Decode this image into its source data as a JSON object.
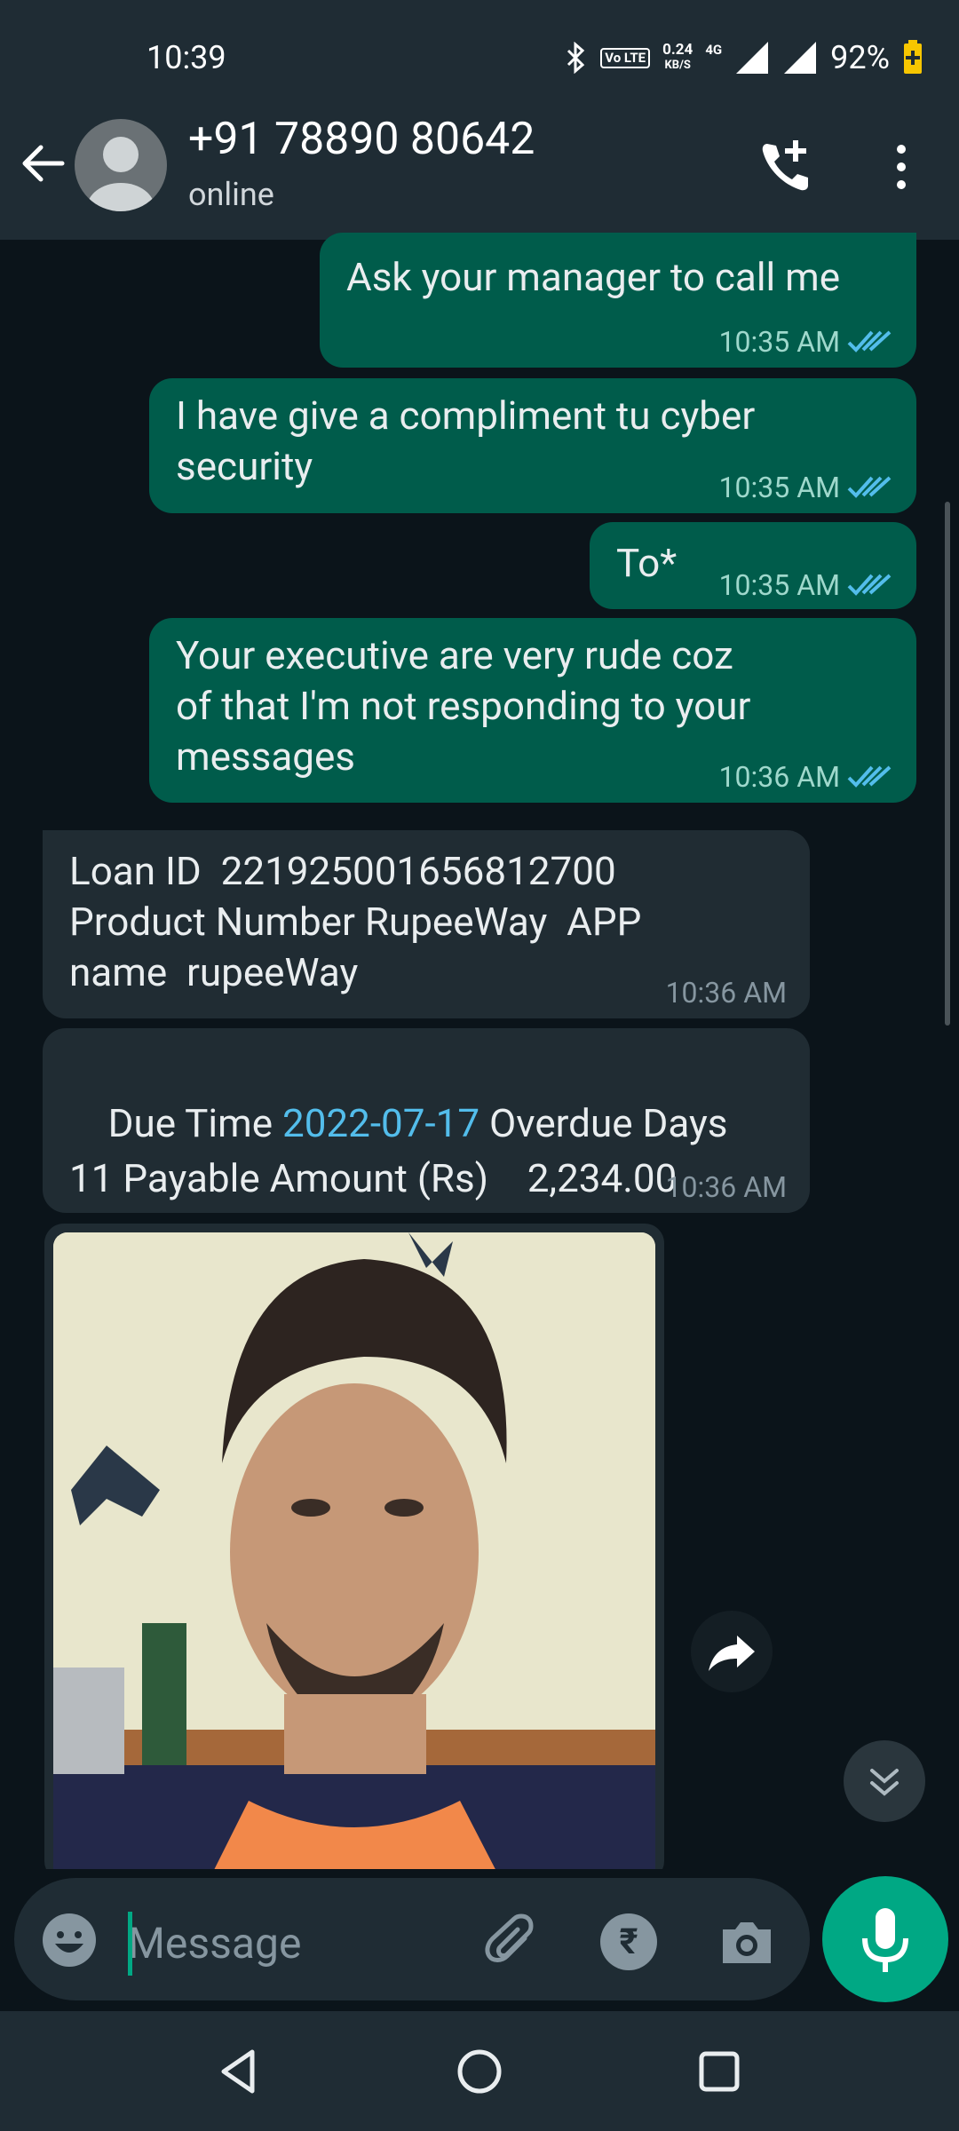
{
  "status_bar": {
    "time": "10:39",
    "volte": "Vo LTE",
    "speed_value": "0.24",
    "speed_unit": "KB/S",
    "network": "4G",
    "battery": "92%"
  },
  "header": {
    "contact_name": "+91 78890 80642",
    "contact_status": "online"
  },
  "messages": [
    {
      "type": "outgoing",
      "text": "Ask your manager to call me",
      "time": "10:35 AM"
    },
    {
      "type": "outgoing",
      "text": "I have give a compliment tu cyber\nsecurity",
      "time": "10:35 AM"
    },
    {
      "type": "outgoing",
      "text": "To*",
      "time": "10:35 AM"
    },
    {
      "type": "outgoing",
      "text": "Your executive are very rude coz\nof that I'm not responding to your\nmessages",
      "time": "10:36 AM"
    },
    {
      "type": "incoming",
      "text": "Loan ID  221925001656812700\nProduct Number RupeeWay  APP\nname  rupeeWay",
      "time": "10:36 AM"
    },
    {
      "type": "incoming",
      "text_before": "Due Time ",
      "link": "2022-07-17",
      "text_after": " Overdue Days\n11 Payable Amount (Rs)    2,234.00",
      "time": "10:36 AM"
    }
  ],
  "input": {
    "placeholder": "Message",
    "rupee_symbol": "₹"
  },
  "colors": {
    "outgoing_bubble": "#005c4b",
    "incoming_bubble": "#202c33",
    "accent": "#00a884",
    "link": "#53bdeb",
    "read_ticks": "#53bdeb"
  }
}
